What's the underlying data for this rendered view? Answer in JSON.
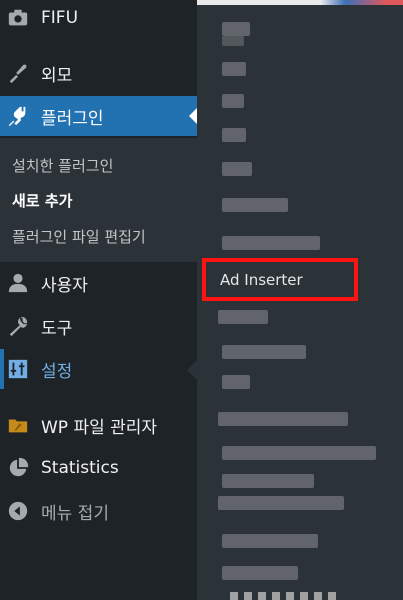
{
  "menu": {
    "fifu": "FIFU",
    "appearance": "외모",
    "plugins": "플러그인",
    "users": "사용자",
    "tools": "도구",
    "settings": "설정",
    "wp_file_manager": "WP 파일 관리자",
    "statistics": "Statistics",
    "collapse_menu": "메뉴 접기"
  },
  "submenu": {
    "installed_plugins": "설치한 플러그인",
    "add_new": "새로 추가",
    "plugin_file_editor": "플러그인 파일 편집기"
  },
  "flyout": {
    "highlighted_item": "Ad Inserter"
  },
  "colors": {
    "sidebar_bg": "#1d2327",
    "submenu_bg": "#2c3338",
    "active_bg": "#2271b1",
    "highlight_border": "#ff1414"
  }
}
